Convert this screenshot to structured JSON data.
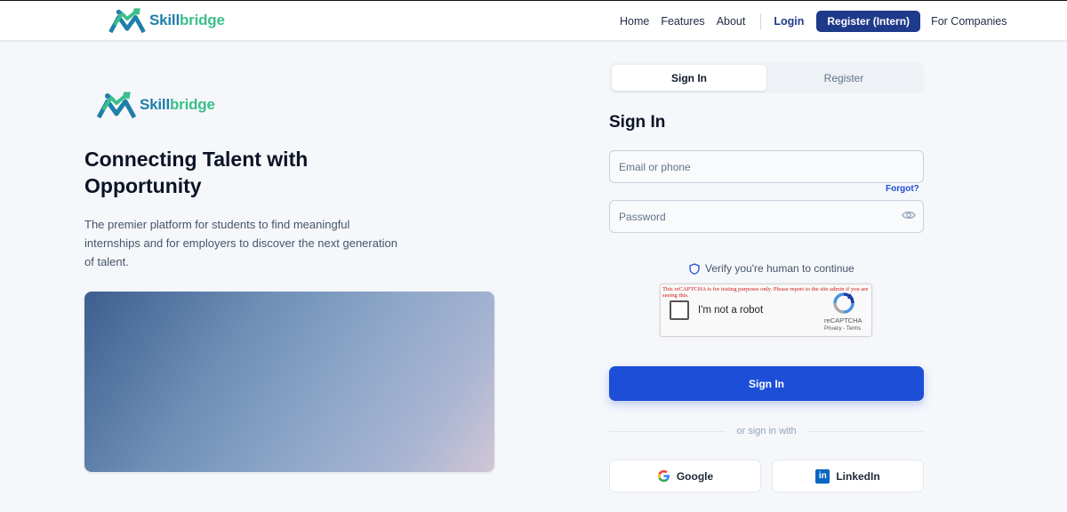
{
  "brand": {
    "part1": "Skill",
    "part2": "bridge"
  },
  "nav": {
    "links": [
      "Home",
      "Features",
      "About"
    ],
    "login": "Login",
    "register": "Register (Intern)",
    "companies": "For Companies"
  },
  "hero": {
    "title": "Connecting Talent with Opportunity",
    "subtitle": "The premier platform for students to find meaningful internships and for employers to discover the next generation of talent."
  },
  "auth": {
    "tabs": [
      {
        "label": "Sign In",
        "active": true
      },
      {
        "label": "Register",
        "active": false
      }
    ],
    "title": "Sign In",
    "email_placeholder": "Email or phone",
    "password_placeholder": "Password",
    "forgot": "Forgot?",
    "verify_text": "Verify you're human to continue",
    "recaptcha": {
      "warning": "This reCAPTCHA is for testing purposes only. Please report to the site admin if you are seeing this.",
      "label": "I'm not a robot",
      "brand": "reCAPTCHA",
      "links": "Privacy - Terms"
    },
    "submit": "Sign In",
    "divider": "or sign in with",
    "social": {
      "google": "Google",
      "linkedin": "LinkedIn"
    }
  },
  "colors": {
    "primary": "#1d4ed8",
    "navy": "#1e3a8a",
    "brand_blue": "#1e7fa8",
    "brand_green": "#3bbf8a"
  }
}
